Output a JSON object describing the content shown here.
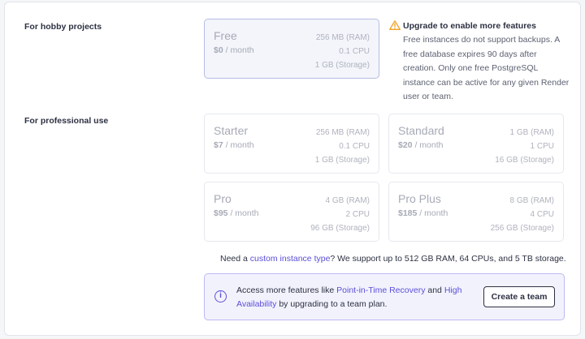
{
  "sections": {
    "hobby": "For hobby projects",
    "professional": "For professional use"
  },
  "plans": {
    "free": {
      "name": "Free",
      "price": "$0",
      "period": " / month",
      "ram": "256 MB (RAM)",
      "cpu": "0.1 CPU",
      "storage": "1 GB (Storage)"
    },
    "starter": {
      "name": "Starter",
      "price": "$7",
      "period": " / month",
      "ram": "256 MB (RAM)",
      "cpu": "0.1 CPU",
      "storage": "1 GB (Storage)"
    },
    "standard": {
      "name": "Standard",
      "price": "$20",
      "period": " / month",
      "ram": "1 GB (RAM)",
      "cpu": "1 CPU",
      "storage": "16 GB (Storage)"
    },
    "pro": {
      "name": "Pro",
      "price": "$95",
      "period": " / month",
      "ram": "4 GB (RAM)",
      "cpu": "2 CPU",
      "storage": "96 GB (Storage)"
    },
    "proplus": {
      "name": "Pro Plus",
      "price": "$185",
      "period": " / month",
      "ram": "8 GB (RAM)",
      "cpu": "4 CPU",
      "storage": "256 GB (Storage)"
    }
  },
  "warning": {
    "title": "Upgrade to enable more features",
    "body": "Free instances do not support backups. A free database expires 90 days after creation. Only one free PostgreSQL instance can be active for any given Render user or team."
  },
  "custom": {
    "prefix": "Need a ",
    "link": "custom instance type",
    "suffix": "? We support up to 512 GB RAM, 64 CPUs, and 5 TB storage."
  },
  "info": {
    "prefix": "Access more features like ",
    "link1": "Point-in-Time Recovery",
    "middle": " and ",
    "link2": "High Availability",
    "suffix": " by upgrading to a team plan.",
    "button": "Create a team"
  },
  "colors": {
    "accent": "#5b4fd8",
    "warning": "#f0a020",
    "selected_border": "#b7bde2"
  },
  "icons": {
    "warning": "warning-triangle-icon",
    "info": "info-circle-icon"
  }
}
